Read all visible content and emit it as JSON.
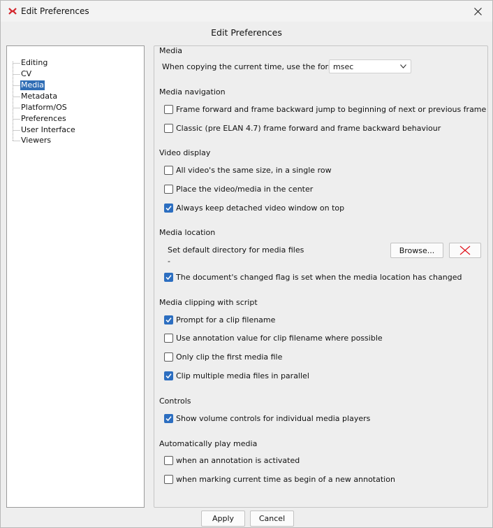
{
  "window": {
    "title": "Edit Preferences",
    "heading": "Edit Preferences"
  },
  "tree": {
    "items": [
      {
        "label": "Editing",
        "selected": false
      },
      {
        "label": "CV",
        "selected": false
      },
      {
        "label": "Media",
        "selected": true
      },
      {
        "label": "Metadata",
        "selected": false
      },
      {
        "label": "Platform/OS",
        "selected": false
      },
      {
        "label": "Preferences",
        "selected": false
      },
      {
        "label": "User Interface",
        "selected": false
      },
      {
        "label": "Viewers",
        "selected": false
      }
    ]
  },
  "media": {
    "legend": "Media",
    "copy_time_label": "When copying the current time, use the format",
    "copy_time_format": "msec",
    "navigation": {
      "title": "Media navigation",
      "frame_jump": {
        "label": "Frame forward and frame backward jump to beginning of next or previous frame",
        "checked": false
      },
      "classic": {
        "label": "Classic (pre ELAN 4.7) frame forward and frame backward behaviour",
        "checked": false
      }
    },
    "video": {
      "title": "Video display",
      "same_size": {
        "label": "All video's the same size, in a single row",
        "checked": false
      },
      "center": {
        "label": "Place the video/media in the center",
        "checked": false
      },
      "on_top": {
        "label": "Always keep detached video window on top",
        "checked": true
      }
    },
    "location": {
      "title": "Media location",
      "default_dir_label": "Set default directory for media files",
      "default_dir_value": "-",
      "browse_label": "Browse...",
      "changed_flag": {
        "label": "The document's changed flag is set when the media location has changed",
        "checked": true
      }
    },
    "clipping": {
      "title": "Media clipping with script",
      "prompt": {
        "label": "Prompt for a clip filename",
        "checked": true
      },
      "annotation_value": {
        "label": "Use annotation value for clip filename where possible",
        "checked": false
      },
      "first_only": {
        "label": "Only clip the first media file",
        "checked": false
      },
      "parallel": {
        "label": "Clip multiple media files in parallel",
        "checked": true
      }
    },
    "controls": {
      "title": "Controls",
      "volume": {
        "label": "Show volume controls for individual media players",
        "checked": true
      }
    },
    "autoplay": {
      "title": "Automatically play media",
      "on_activate": {
        "label": "when an annotation is activated",
        "checked": false
      },
      "on_mark": {
        "label": "when marking current time as begin of a new annotation",
        "checked": false
      }
    }
  },
  "buttons": {
    "apply": "Apply",
    "cancel": "Cancel"
  },
  "colors": {
    "accent": "#2c6ec0",
    "selection": "#2f6db5",
    "clear_icon": "#e0141e"
  }
}
